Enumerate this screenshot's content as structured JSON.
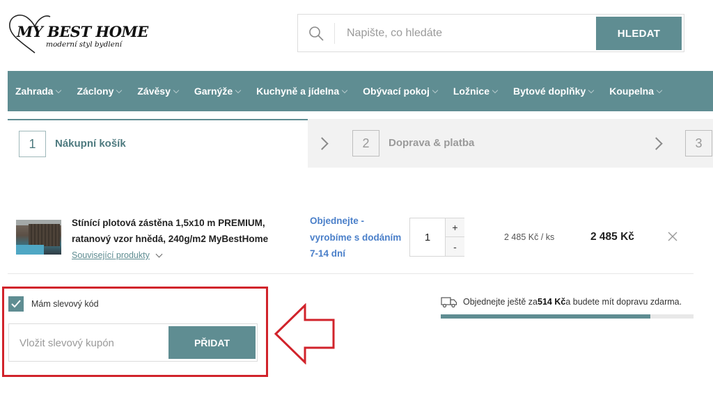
{
  "logo": {
    "main": "MY BEST HOME",
    "tagline": "moderní styl bydlení"
  },
  "search": {
    "placeholder": "Napište, co hledáte",
    "button": "HLEDAT"
  },
  "nav": {
    "items": [
      {
        "label": "Zahrada"
      },
      {
        "label": "Záclony"
      },
      {
        "label": "Závěsy"
      },
      {
        "label": "Garnýže"
      },
      {
        "label": "Kuchyně a jídelna"
      },
      {
        "label": "Obývací pokoj"
      },
      {
        "label": "Ložnice"
      },
      {
        "label": "Bytové doplňky"
      },
      {
        "label": "Koupelna"
      }
    ]
  },
  "steps": [
    {
      "number": "1",
      "label": "Nákupní košík"
    },
    {
      "number": "2",
      "label": "Doprava & platba"
    },
    {
      "number": "3",
      "label": ""
    }
  ],
  "cart": {
    "item": {
      "name": "Stínící plotová zástěna 1,5x10 m PREMIUM, ratanový vzor hnědá, 240g/m2 MyBestHome",
      "related": "Související produkty",
      "availability": "Objednejte - vyrobíme s dodáním 7-14 dní",
      "quantity": "1",
      "plus": "+",
      "minus": "-",
      "unit_price": "2 485 Kč / ks",
      "total": "2 485 Kč"
    }
  },
  "coupon": {
    "checkbox_label": "Mám slevový kód",
    "checked": true,
    "placeholder": "Vložit slevový kupón",
    "button": "PŘIDAT"
  },
  "shipping": {
    "text_before": "Objednejte ještě za ",
    "amount": "514 Kč",
    "text_after": " a budete mít dopravu zdarma.",
    "progress": 0.83
  },
  "colors": {
    "accent": "#5f8d92",
    "link": "#4a7fc9",
    "highlight": "#d1232b"
  }
}
